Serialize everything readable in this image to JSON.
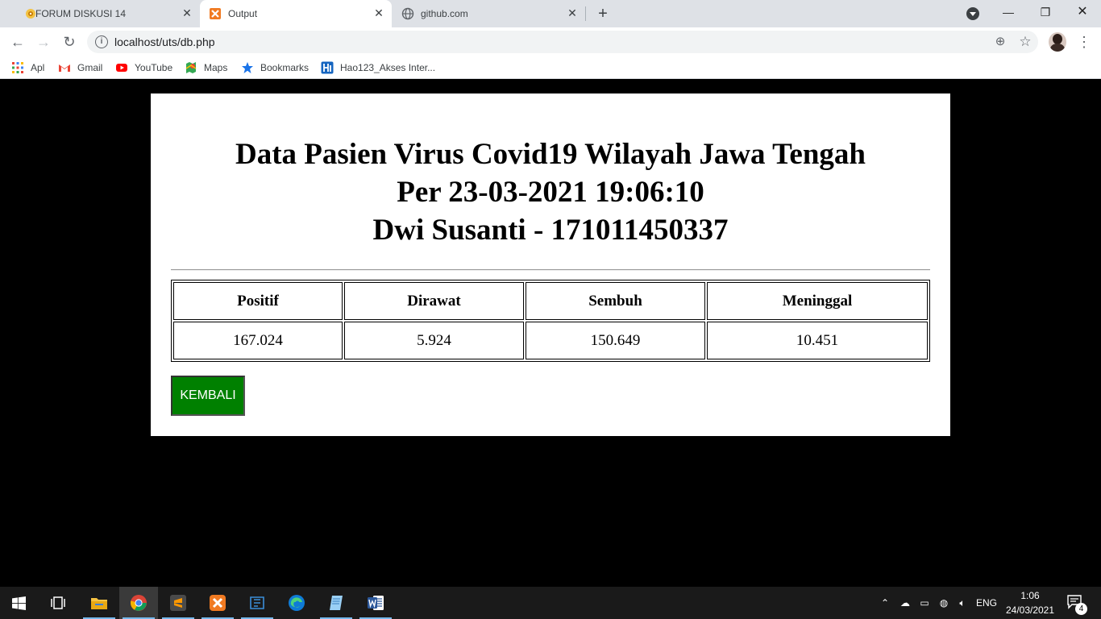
{
  "browser": {
    "tabs": [
      {
        "title": "FORUM DISKUSI 14",
        "active": false
      },
      {
        "title": "Output",
        "active": true
      },
      {
        "title": "github.com",
        "active": false
      }
    ],
    "new_tab_label": "+",
    "url": "localhost/uts/db.php",
    "bookmarks": [
      {
        "label": "Apl",
        "icon": "apps-grid-icon"
      },
      {
        "label": "Gmail",
        "icon": "gmail-icon"
      },
      {
        "label": "YouTube",
        "icon": "youtube-icon"
      },
      {
        "label": "Maps",
        "icon": "maps-icon"
      },
      {
        "label": "Bookmarks",
        "icon": "star-icon"
      },
      {
        "label": "Hao123_Akses Inter...",
        "icon": "hao123-icon"
      }
    ]
  },
  "page": {
    "heading_lines": [
      "Data Pasien Virus Covid19 Wilayah Jawa Tengah",
      "Per 23-03-2021 19:06:10",
      "Dwi Susanti - 171011450337"
    ],
    "table": {
      "headers": [
        "Positif",
        "Dirawat",
        "Sembuh",
        "Meninggal"
      ],
      "rows": [
        [
          "167.024",
          "5.924",
          "150.649",
          "10.451"
        ]
      ]
    },
    "back_button": "KEMBALI"
  },
  "taskbar": {
    "language": "ENG",
    "time": "1:06",
    "date": "24/03/2021",
    "notification_count": "4"
  },
  "colors": {
    "button_green": "#008000",
    "page_background": "#000000",
    "card_background": "#ffffff"
  }
}
